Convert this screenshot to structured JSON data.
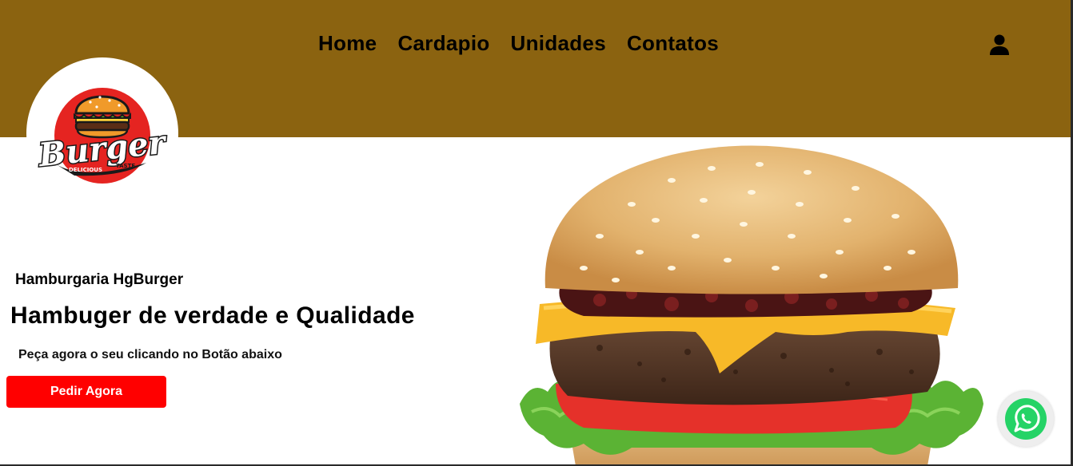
{
  "nav": {
    "items": [
      {
        "label": "Home",
        "name": "nav-home"
      },
      {
        "label": "Cardapio",
        "name": "nav-cardapio"
      },
      {
        "label": "Unidades",
        "name": "nav-unidades"
      },
      {
        "label": "Contatos",
        "name": "nav-contatos"
      }
    ],
    "user_icon": "user-icon"
  },
  "logo": {
    "brand_word": "Burger",
    "tagline_left": "DELICIOUS",
    "tagline_right": "TASTE",
    "icon": "burger-logo-icon"
  },
  "hero": {
    "subtitle": "Hamburgaria HgBurger",
    "headline": "Hambuger de verdade e Qualidade",
    "tagline": "Peça agora o seu clicando no Botão abaixo",
    "cta_label": "Pedir Agora",
    "image": "burger-photo"
  },
  "whatsapp": {
    "icon": "whatsapp-icon"
  },
  "colors": {
    "header_bg": "#8b6310",
    "cta_bg": "#ff0000",
    "whatsapp_green": "#25d366"
  }
}
